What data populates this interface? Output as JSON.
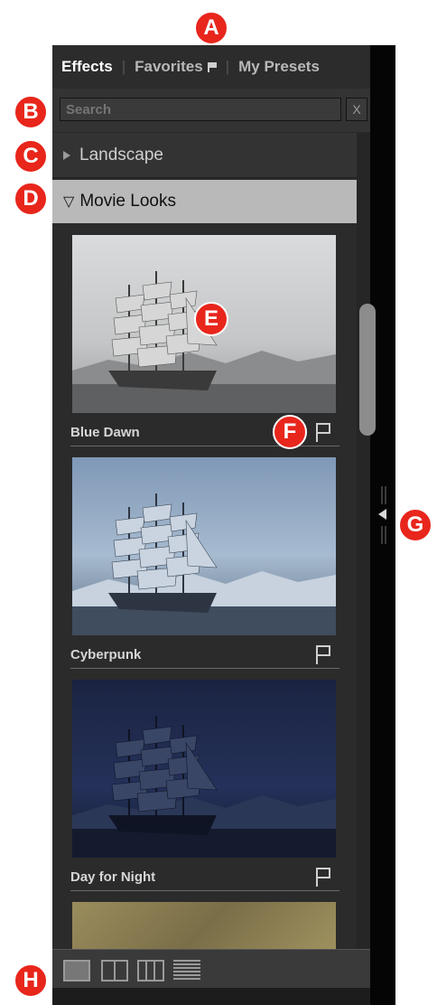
{
  "callouts": {
    "a": "A",
    "b": "B",
    "c": "C",
    "d": "D",
    "e": "E",
    "f": "F",
    "g": "G",
    "h": "H"
  },
  "tabs": [
    {
      "label": "Effects",
      "active": true
    },
    {
      "label": "Favorites",
      "icon": "flag-icon"
    },
    {
      "label": "My Presets"
    }
  ],
  "search": {
    "placeholder": "Search",
    "clear_label": "X"
  },
  "categories": [
    {
      "label": "Landscape",
      "state": "collapsed",
      "icon": "triangle-right-icon"
    },
    {
      "label": "Movie Looks",
      "state": "expanded",
      "icon": "triangle-down-icon"
    }
  ],
  "presets": [
    {
      "name": "Blue Dawn",
      "icon": "flag-outline-icon"
    },
    {
      "name": "Cyberpunk",
      "icon": "flag-outline-icon"
    },
    {
      "name": "Day for Night",
      "icon": "flag-outline-icon"
    }
  ],
  "view_modes": [
    "single-column-view-icon",
    "two-column-view-icon",
    "three-column-view-icon",
    "list-view-icon"
  ],
  "colors": {
    "panel": "#2a2a2a",
    "selected_category": "#b9b9b9",
    "callout": "#e8261c"
  }
}
